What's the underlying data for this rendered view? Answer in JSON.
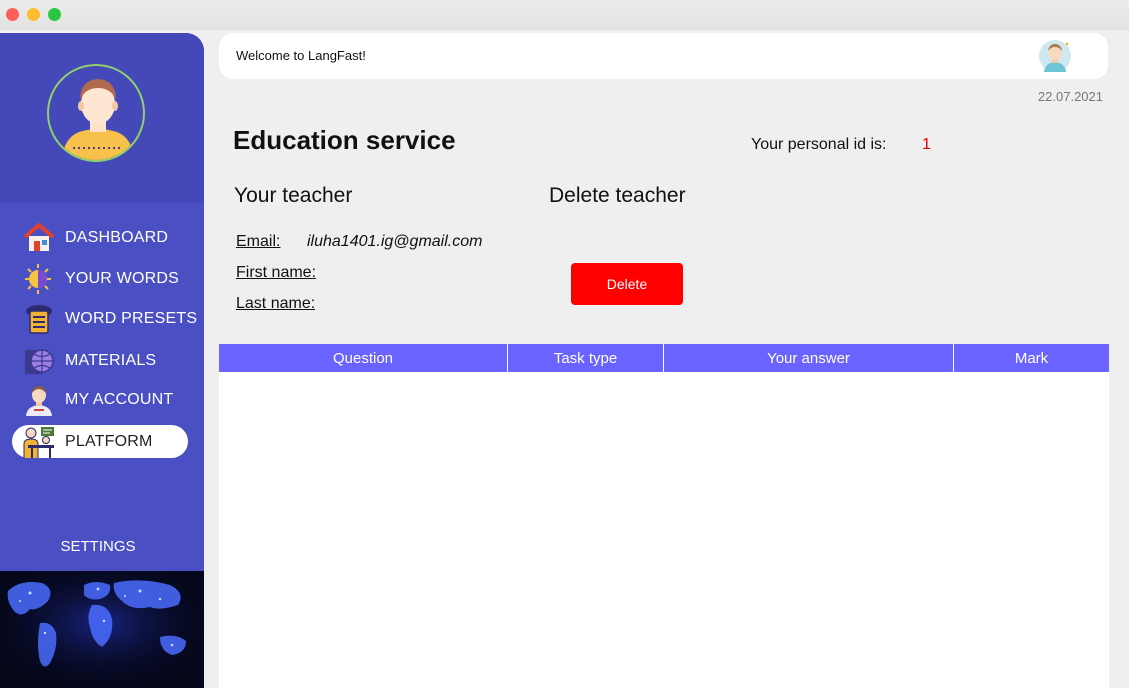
{
  "window": {
    "controls": [
      "close",
      "minimize",
      "maximize"
    ]
  },
  "sidebar": {
    "items": [
      {
        "label": "DASHBOARD",
        "icon": "house-icon"
      },
      {
        "label": "YOUR WORDS",
        "icon": "words-icon"
      },
      {
        "label": "WORD PRESETS",
        "icon": "presets-icon"
      },
      {
        "label": "MATERIALS",
        "icon": "materials-icon"
      },
      {
        "label": "MY ACCOUNT",
        "icon": "account-icon"
      },
      {
        "label": "PLATFORM",
        "icon": "platform-icon",
        "active": true
      }
    ],
    "settings_label": "SETTINGS"
  },
  "header": {
    "welcome": "Welcome to LangFast!",
    "date": "22.07.2021"
  },
  "main": {
    "title": "Education service",
    "personal_id_label": "Your personal id is:",
    "personal_id_value": "1",
    "your_teacher_heading": "Your teacher",
    "delete_teacher_heading": "Delete teacher",
    "email_label": "Email:",
    "email_value": "iluha1401.ig@gmail.com",
    "first_name_label": "First name:",
    "last_name_label": "Last name:",
    "delete_button": "Delete"
  },
  "table": {
    "columns": [
      "Question",
      "Task type",
      "Your answer",
      "Mark"
    ],
    "rows": []
  },
  "colors": {
    "sidebar": "#4b4fc4",
    "accent_header": "#6b63ff",
    "delete": "#ff0000",
    "id_value": "#e00000"
  }
}
